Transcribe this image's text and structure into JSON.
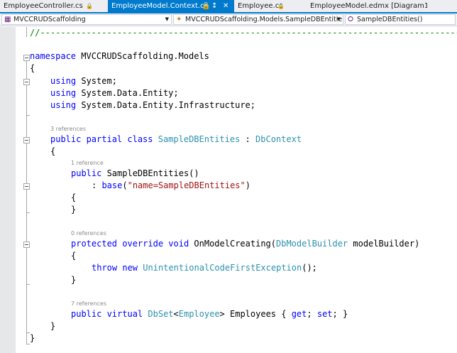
{
  "tabs": [
    {
      "label": "EmployeeController.cs"
    },
    {
      "label": "EmployeeModel.Context.cs"
    },
    {
      "label": "Employee.cs"
    },
    {
      "label": "EmployeeModel.edmx [Diagram1]"
    }
  ],
  "navbar": {
    "project": "MVCCRUDScaffolding",
    "type": "MVCCRUDScaffolding.Models.SampleDBEntitie",
    "member": "SampleDBEntities()"
  },
  "code": {
    "header_comment": "//----------------------------------------------------------------------------------",
    "ns_kw": "namespace",
    "ns_name": " MVCCRUDScaffolding.Models",
    "open_ns": "{",
    "using_kw": "using",
    "using1": " System;",
    "using2": " System.Data.Entity;",
    "using3": " System.Data.Entity.Infrastructure;",
    "lens_class": "3 references",
    "class_mods": "public partial class",
    "class_name": "SampleDBEntities",
    "colon": " : ",
    "base_type": "DbContext",
    "open_class": "{",
    "lens_ctor": "1 reference",
    "ctor_public": "public",
    "ctor_name": " SampleDBEntities()",
    "base_prefix": ": ",
    "base_kw": "base",
    "base_open": "(",
    "base_arg": "\"name=SampleDBEntities\"",
    "base_close": ")",
    "ctor_open": "{",
    "ctor_close": "}",
    "lens_method": "0 references",
    "method_mods": "protected override void",
    "method_name": " OnModelCreating(",
    "method_param_type": "DbModelBuilder",
    "method_param": " modelBuilder)",
    "method_open": "{",
    "throw_kw": "throw new",
    "exception_type": "UnintentionalCodeFirstException",
    "throw_end": "();",
    "method_close": "}",
    "lens_prop": "7 references",
    "prop_mods": "public virtual",
    "prop_type": "DbSet",
    "prop_lt": "<",
    "prop_generic": "Employee",
    "prop_gt": ">",
    "prop_name": " Employees { ",
    "get_kw": "get",
    "semi1": "; ",
    "set_kw": "set",
    "semi2": "; }",
    "close_class": "}",
    "close_ns": "}"
  },
  "colors": {
    "accent": "#007acc",
    "keyword": "#0000ff",
    "type": "#2b91af",
    "string": "#a31515",
    "comment": "#008000"
  },
  "icons": {
    "project": "csharp-project-icon",
    "type": "class-icon",
    "member": "method-icon",
    "pin": "pin-icon",
    "close": "close-icon"
  }
}
